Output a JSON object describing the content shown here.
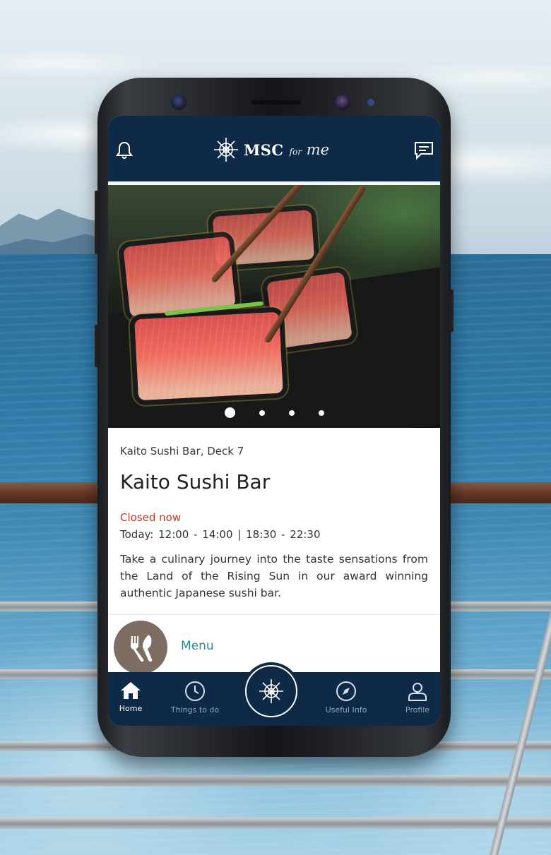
{
  "app": {
    "logo_text": "MSC",
    "logo_sub_small": "for",
    "logo_sub": "me"
  },
  "header": {
    "left_icon": "bell-icon",
    "right_icon": "chat-icon"
  },
  "hero": {
    "slide_count": 4,
    "active_slide": 1
  },
  "venue": {
    "location": "Kaito Sushi Bar, Deck 7",
    "name": "Kaito Sushi Bar",
    "status": "Closed now",
    "hours": "Today:  12:00 - 14:00  |  18:30 - 22:30",
    "description": "Take a culinary journey into the taste sensations from the Land of the Rising Sun in our award winning authentic Japanese sushi bar.",
    "status_color": "#c0392b"
  },
  "menu": {
    "label": "Menu",
    "icon": "cutlery-icon"
  },
  "bottom_nav": {
    "items": [
      {
        "label": "Home",
        "icon": "home-icon",
        "active": true
      },
      {
        "label": "Things to do",
        "icon": "clock-icon",
        "active": false
      },
      {
        "label": "",
        "icon": "compass-rose-icon",
        "active": false
      },
      {
        "label": "Useful Info",
        "icon": "compass-icon",
        "active": false
      },
      {
        "label": "Profile",
        "icon": "user-icon",
        "active": false
      }
    ]
  },
  "colors": {
    "header_bg": "#0f2a46",
    "accent_teal": "#2b8b93",
    "menu_circle": "#7d6d62"
  }
}
